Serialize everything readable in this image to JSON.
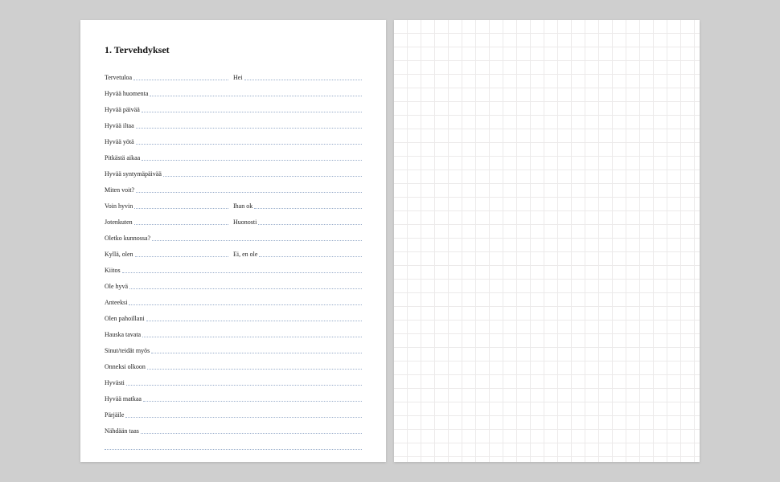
{
  "document": {
    "heading": "1. Tervehdykset",
    "rows": [
      {
        "type": "pair",
        "left": "Tervetuloa",
        "right": "Hei"
      },
      {
        "type": "single",
        "text": "Hyvää huomenta"
      },
      {
        "type": "single",
        "text": "Hyvää päivää"
      },
      {
        "type": "single",
        "text": "Hyvää iltaa"
      },
      {
        "type": "single",
        "text": "Hyvää yötä"
      },
      {
        "type": "single",
        "text": "Pitkästä aikaa"
      },
      {
        "type": "single",
        "text": "Hyvää syntymäpäivää"
      },
      {
        "type": "single",
        "text": "Miten voit?"
      },
      {
        "type": "pair",
        "left": "Voin hyvin",
        "right": "Ihan ok"
      },
      {
        "type": "pair",
        "left": "Jotenkuten",
        "right": "Huonosti"
      },
      {
        "type": "single",
        "text": "Oletko kunnossa?"
      },
      {
        "type": "pair",
        "left": "Kyllä, olen",
        "right": "Ei, en ole"
      },
      {
        "type": "single",
        "text": "Kiitos"
      },
      {
        "type": "single",
        "text": "Ole hyvä"
      },
      {
        "type": "single",
        "text": "Anteeksi"
      },
      {
        "type": "single",
        "text": "Olen pahoillani"
      },
      {
        "type": "single",
        "text": "Hauska tavata"
      },
      {
        "type": "single",
        "text": "Sinut/teidät myös"
      },
      {
        "type": "single",
        "text": "Onneksi olkoon"
      },
      {
        "type": "single",
        "text": "Hyvästi"
      },
      {
        "type": "single",
        "text": "Hyvää matkaa"
      },
      {
        "type": "single",
        "text": "Pärjäile"
      },
      {
        "type": "single",
        "text": "Nähdään taas"
      }
    ]
  }
}
